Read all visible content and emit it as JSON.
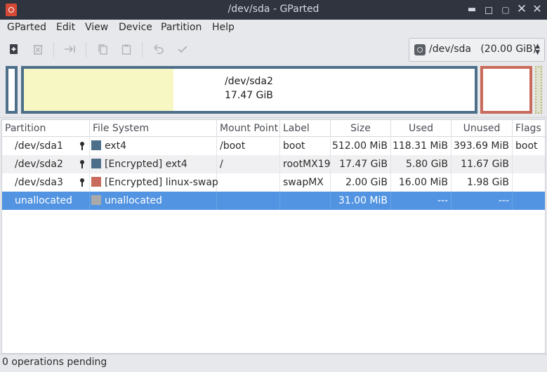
{
  "window": {
    "title": "/dev/sda - GParted"
  },
  "menu": [
    "GParted",
    "Edit",
    "View",
    "Device",
    "Partition",
    "Help"
  ],
  "toolbar": {
    "icons": [
      "new-icon",
      "delete-icon",
      "resize-move-icon",
      "copy-icon",
      "paste-icon",
      "undo-icon",
      "apply-icon"
    ]
  },
  "device_selector": {
    "value": "/dev/sda   (20.00 GiB)"
  },
  "disk_graph": {
    "main_label": "/dev/sda2",
    "main_size": "17.47 GiB"
  },
  "table": {
    "columns": [
      "Partition",
      "File System",
      "Mount Point",
      "Label",
      "Size",
      "Used",
      "Unused",
      "Flags"
    ],
    "rows": [
      {
        "partition": "/dev/sda1",
        "fs": "ext4",
        "fs_color": "#4d6f8a",
        "mount": "/boot",
        "label": "boot",
        "size": "512.00 MiB",
        "used": "118.31 MiB",
        "unused": "393.69 MiB",
        "flags": "boot",
        "locked": true
      },
      {
        "partition": "/dev/sda2",
        "fs": "[Encrypted] ext4",
        "fs_color": "#4d6f8a",
        "mount": "/",
        "label": "rootMX19",
        "size": "17.47 GiB",
        "used": "5.80 GiB",
        "unused": "11.67 GiB",
        "flags": "",
        "locked": true
      },
      {
        "partition": "/dev/sda3",
        "fs": "[Encrypted] linux-swap",
        "fs_color": "#c96b5c",
        "mount": "",
        "label": "swapMX",
        "size": "2.00 GiB",
        "used": "16.00 MiB",
        "unused": "1.98 GiB",
        "flags": "",
        "locked": true
      },
      {
        "partition": "unallocated",
        "fs": "unallocated",
        "fs_color": "#a9a9a9",
        "mount": "",
        "label": "",
        "size": "31.00 MiB",
        "used": "---",
        "unused": "---",
        "flags": "",
        "locked": false
      }
    ]
  },
  "status": {
    "text": "0 operations pending"
  },
  "colors": {
    "ext4": "#4d6f8a",
    "swap": "#c96b5c",
    "selection": "#5294e2",
    "used_fill": "#f7f7c3"
  }
}
